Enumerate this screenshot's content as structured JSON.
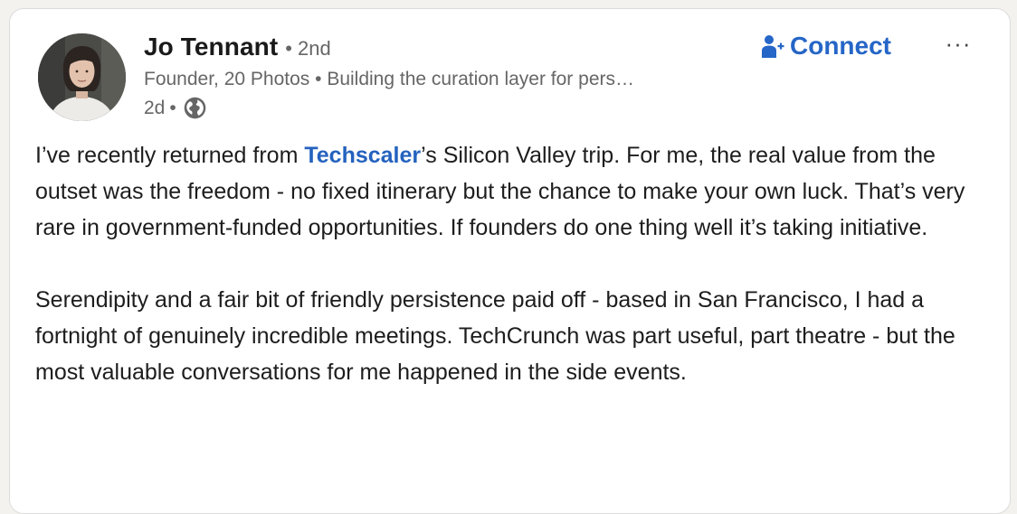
{
  "post": {
    "author": {
      "name": "Jo Tennant",
      "degree": "2nd",
      "degree_separator": "•",
      "headline": "Founder, 20 Photos • Building the curation layer for pers…",
      "time_ago": "2d",
      "time_separator": "•",
      "visibility_icon": "globe-icon",
      "avatar_icon": "profile-photo"
    },
    "actions": {
      "connect_label": "Connect",
      "connect_icon": "add-person-icon",
      "more_label": "···",
      "more_icon": "ellipsis-icon"
    },
    "body": {
      "p1_before": "I’ve recently returned from ",
      "p1_mention": "Techscaler",
      "p1_after": "’s Silicon Valley trip. For me, the real value from the outset was the freedom - no fixed itinerary but the chance to make your own luck. That’s very rare in government-funded opportunities. If founders do one thing well it’s taking initiative.",
      "p2": "Serendipity and a fair bit of friendly persistence paid off - based in San Francisco, I had a fortnight of genuinely incredible meetings. TechCrunch was part useful, part theatre - but the most valuable conversations for me happened in the side events."
    },
    "colors": {
      "accent": "#2566c7",
      "mention": "#2462be",
      "text": "#1d1d1d",
      "muted": "#666666"
    }
  }
}
